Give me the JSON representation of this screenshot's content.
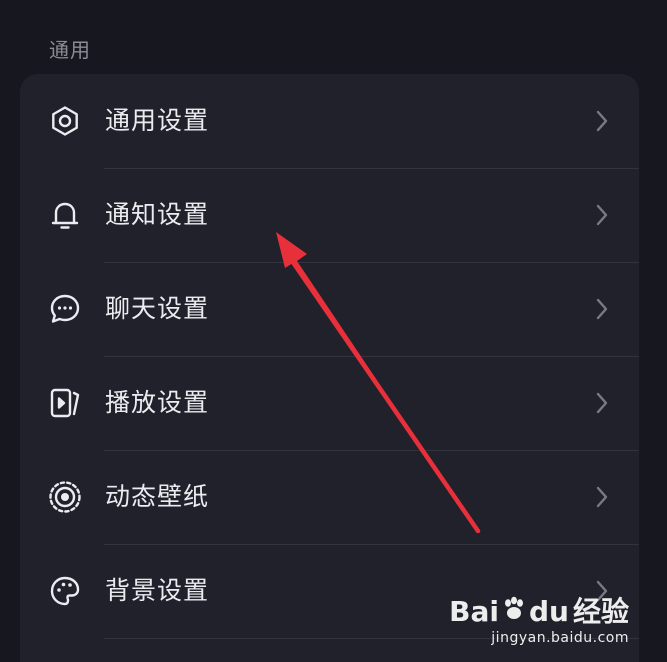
{
  "section": {
    "title": "通用"
  },
  "rows": [
    {
      "icon": "gear-icon",
      "label": "通用设置"
    },
    {
      "icon": "bell-icon",
      "label": "通知设置"
    },
    {
      "icon": "chat-bubble-icon",
      "label": "聊天设置"
    },
    {
      "icon": "play-device-icon",
      "label": "播放设置"
    },
    {
      "icon": "dynamic-wallpaper-icon",
      "label": "动态壁纸"
    },
    {
      "icon": "palette-icon",
      "label": "背景设置"
    }
  ],
  "watermark": {
    "brand_left": "Bai",
    "brand_right": "du",
    "suffix": "经验",
    "url": "jingyan.baidu.com"
  },
  "colors": {
    "background": "#17171f",
    "card": "#21212b",
    "text": "#ececf0",
    "muted": "#8c8c96",
    "divider": "#33333e",
    "annotation_arrow": "#e8303a"
  }
}
